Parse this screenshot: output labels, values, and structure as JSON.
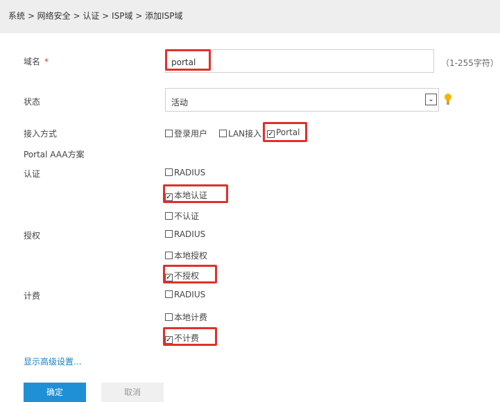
{
  "breadcrumb": "系统 > 网络安全 > 认证 > ISP域 > 添加ISP域",
  "form": {
    "domain_name": {
      "label": "域名",
      "required_mark": "*",
      "value": "portal",
      "hint": "（1-255字符）"
    },
    "status": {
      "label": "状态",
      "selected": "活动"
    },
    "access_method": {
      "label": "接入方式",
      "options": [
        {
          "label": "登录用户",
          "checked": false
        },
        {
          "label": "LAN接入",
          "checked": false
        },
        {
          "label": "Portal",
          "checked": true
        }
      ]
    },
    "aaa_section_title": "Portal AAA方案",
    "auth": {
      "label": "认证",
      "options": [
        {
          "label": "RADIUS",
          "checked": false
        },
        {
          "label": "本地认证",
          "checked": true
        },
        {
          "label": "不认证",
          "checked": false
        }
      ]
    },
    "authorization": {
      "label": "授权",
      "options": [
        {
          "label": "RADIUS",
          "checked": false
        },
        {
          "label": "本地授权",
          "checked": false
        },
        {
          "label": "不授权",
          "checked": true
        }
      ]
    },
    "accounting": {
      "label": "计费",
      "options": [
        {
          "label": "RADIUS",
          "checked": false
        },
        {
          "label": "本地计费",
          "checked": false
        },
        {
          "label": "不计费",
          "checked": true
        }
      ]
    }
  },
  "advanced_link": "显示高级设置...",
  "buttons": {
    "ok": "确定",
    "cancel": "取消"
  },
  "colors": {
    "highlight": "#e0302b",
    "primary": "#1f8fd6",
    "link": "#1a7fc1"
  },
  "icons": {
    "status_hint": "lightbulb-icon",
    "dropdown": "chevron-down-icon"
  }
}
